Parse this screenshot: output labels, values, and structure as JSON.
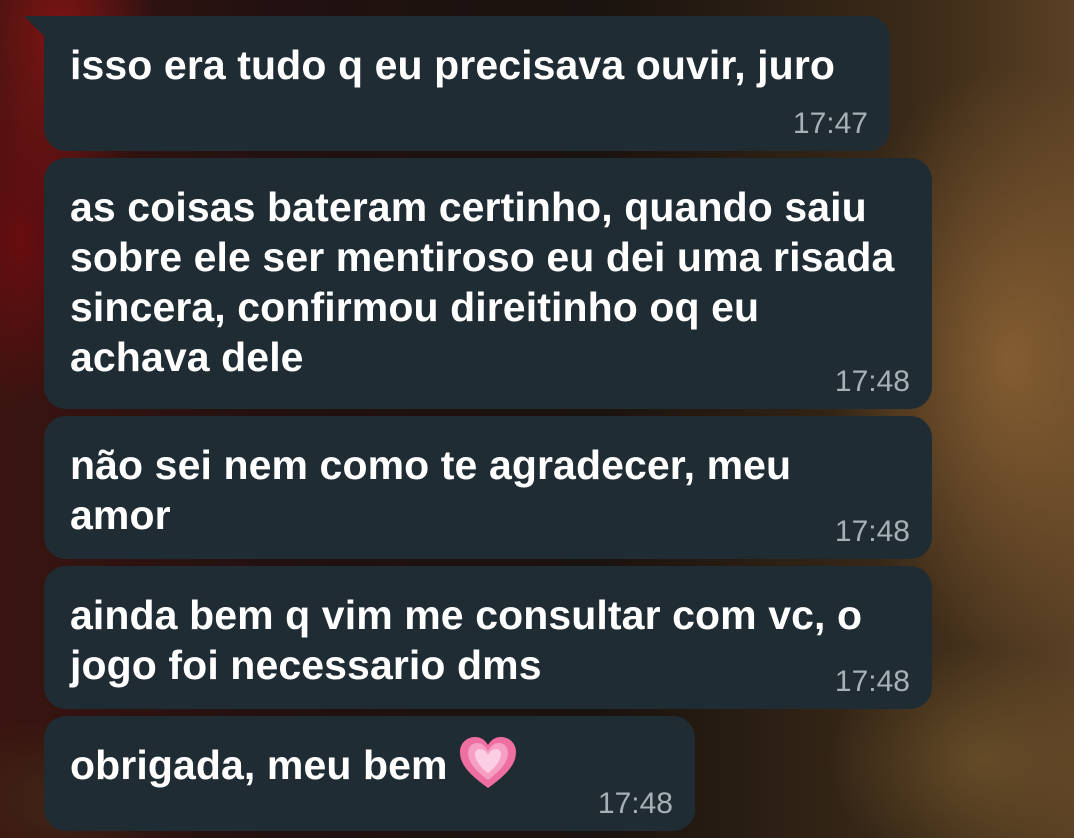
{
  "messages": [
    {
      "text": "isso era tudo q eu precisava ouvir, juro",
      "time": "17:47"
    },
    {
      "text": "as coisas bateram certinho, quando saiu sobre ele ser mentiroso eu dei uma risada sincera, confirmou direitinho oq eu achava dele",
      "time": "17:48"
    },
    {
      "text": "não sei nem como te agradecer, meu amor",
      "time": "17:48"
    },
    {
      "text": "ainda bem q vim me consultar com vc, o jogo foi necessario dms",
      "time": "17:48"
    },
    {
      "text": "obrigada, meu bem",
      "emoji": "pink-heart",
      "time": "17:48"
    }
  ],
  "colors": {
    "bubble": "#202c33",
    "text": "#ffffff",
    "timestamp": "#a5b0b7",
    "heart": "#f06fa2"
  }
}
